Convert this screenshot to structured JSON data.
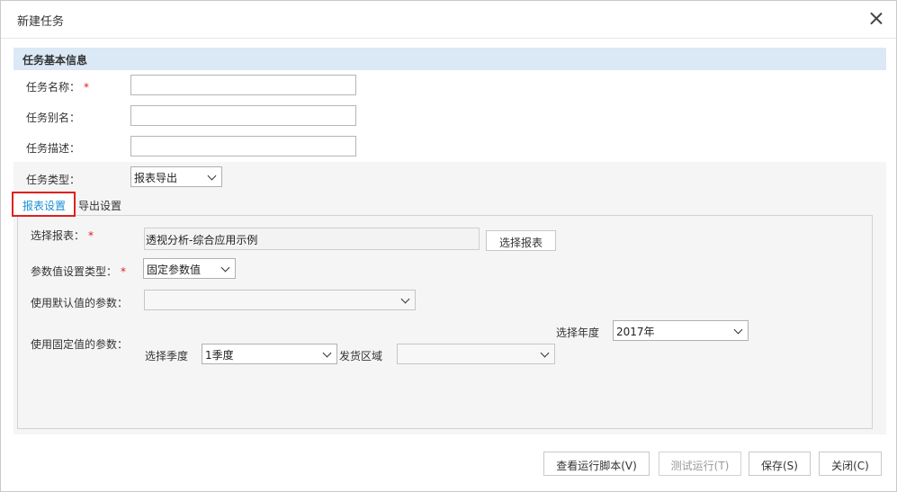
{
  "dialog": {
    "title": "新建任务"
  },
  "basic_info": {
    "header": "任务基本信息",
    "name_label": "任务名称：",
    "name_value": "",
    "alias_label": "任务别名：",
    "alias_value": "",
    "desc_label": "任务描述：",
    "desc_value": "",
    "type_label": "任务类型：",
    "type_selected": "报表导出"
  },
  "tabs": [
    {
      "label": "报表设置",
      "active": true
    },
    {
      "label": "导出设置",
      "active": false
    }
  ],
  "report_settings": {
    "select_report_label": "选择报表：",
    "report_value": "透视分析-综合应用示例",
    "select_report_button": "选择报表",
    "param_type_label": "参数值设置类型：",
    "param_type_selected": "固定参数值",
    "default_params_label": "使用默认值的参数：",
    "default_params_selected": "",
    "fixed_params_label": "使用固定值的参数：",
    "year_label": "选择年度",
    "year_selected": "2017年",
    "quarter_label": "选择季度",
    "quarter_selected": "1季度",
    "region_label": "发货区域",
    "region_selected": ""
  },
  "footer": {
    "view_script": "查看运行脚本(V)",
    "test_run": "测试运行(T)",
    "save": "保存(S)",
    "close": "关闭(C)"
  },
  "colors": {
    "section_header_bg": "#dbe8f5",
    "active_tab_text": "#1a8fd6",
    "highlight_border": "#e02020",
    "required_mark": "#e02020"
  }
}
